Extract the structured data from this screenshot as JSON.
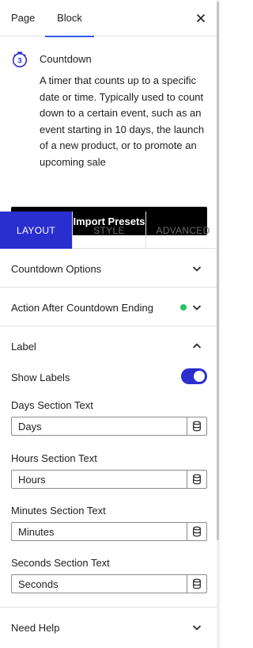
{
  "tabs": {
    "page": "Page",
    "block": "Block"
  },
  "block": {
    "title": "Countdown",
    "description": "A timer that counts up to a specific date or time. Typically used to count down to a certain event, such as an event starting in 10 days, the launch of a new product, or to promote an upcoming sale",
    "import_label": "Import Presets"
  },
  "modes": {
    "layout": "LAYOUT",
    "style": "STYLE",
    "advanced": "ADVANCED"
  },
  "panels": {
    "countdown_options": "Countdown Options",
    "action_after": "Action After Countdown Ending",
    "label": "Label",
    "need_help": "Need Help"
  },
  "label_panel": {
    "show_labels": "Show Labels",
    "show_labels_on": true,
    "days_label": "Days Section Text",
    "days_value": "Days",
    "hours_label": "Hours Section Text",
    "hours_value": "Hours",
    "minutes_label": "Minutes Section Text",
    "minutes_value": "Minutes",
    "seconds_label": "Seconds Section Text",
    "seconds_value": "Seconds"
  },
  "colors": {
    "accent": "#2a2ecf",
    "tab_underline": "#3858e9",
    "status_dot": "#22c55e"
  },
  "icons": [
    "close-icon",
    "timer-icon",
    "chevron-down-icon",
    "chevron-up-icon",
    "database-icon"
  ]
}
